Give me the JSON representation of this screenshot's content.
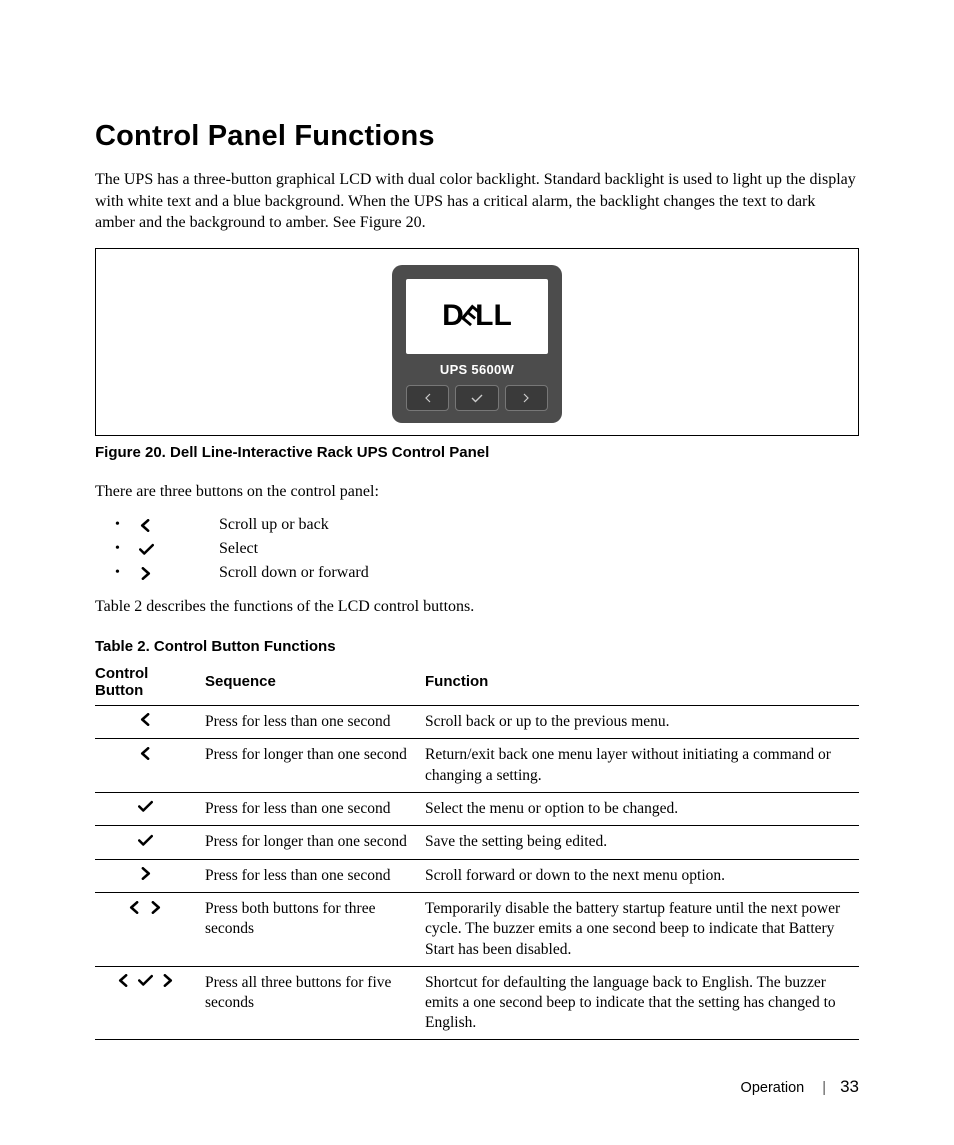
{
  "heading": "Control Panel Functions",
  "intro": "The UPS has a three-button graphical LCD with dual color backlight. Standard backlight is used to light up the display with white text and a blue background. When the UPS has a critical alarm, the backlight changes the text to dark amber and the background to amber. See Figure 20.",
  "device": {
    "logo_letters": [
      "D",
      "E",
      "L",
      "L"
    ],
    "label": "UPS 5600W"
  },
  "figure_caption": "Figure 20. Dell Line-Interactive Rack UPS Control Panel",
  "para_after_figure": "There are three buttons on the control panel:",
  "button_list": [
    {
      "icon": "left",
      "text": "Scroll up or back"
    },
    {
      "icon": "check",
      "text": "Select"
    },
    {
      "icon": "right",
      "text": "Scroll down or forward"
    }
  ],
  "para_before_table": "Table 2 describes the functions of the LCD control buttons.",
  "table_caption": "Table 2. Control Button Functions",
  "table_headers": [
    "Control Button",
    "Sequence",
    "Function"
  ],
  "table_rows": [
    {
      "icons": [
        "left"
      ],
      "sequence": "Press for less than one second",
      "function": "Scroll back or up to the previous menu."
    },
    {
      "icons": [
        "left"
      ],
      "sequence": "Press for longer than one second",
      "function": "Return/exit back one menu layer without initiating a command or changing a setting."
    },
    {
      "icons": [
        "check"
      ],
      "sequence": "Press for less than one second",
      "function": "Select the menu or option to be changed."
    },
    {
      "icons": [
        "check"
      ],
      "sequence": "Press for longer than one second",
      "function": "Save the setting being edited."
    },
    {
      "icons": [
        "right"
      ],
      "sequence": "Press for less than one second",
      "function": "Scroll forward or down to the next menu option."
    },
    {
      "icons": [
        "left",
        "right"
      ],
      "sequence": "Press both buttons for three seconds",
      "function": "Temporarily disable the battery startup feature until the next power cycle. The buzzer emits a one second beep to indicate that Battery Start has been disabled."
    },
    {
      "icons": [
        "left",
        "check",
        "right"
      ],
      "sequence": "Press all three buttons for five seconds",
      "function": "Shortcut for defaulting the language back to English. The buzzer emits a one second beep to indicate that the setting has changed to English."
    }
  ],
  "footer": {
    "section": "Operation",
    "page": "33"
  }
}
